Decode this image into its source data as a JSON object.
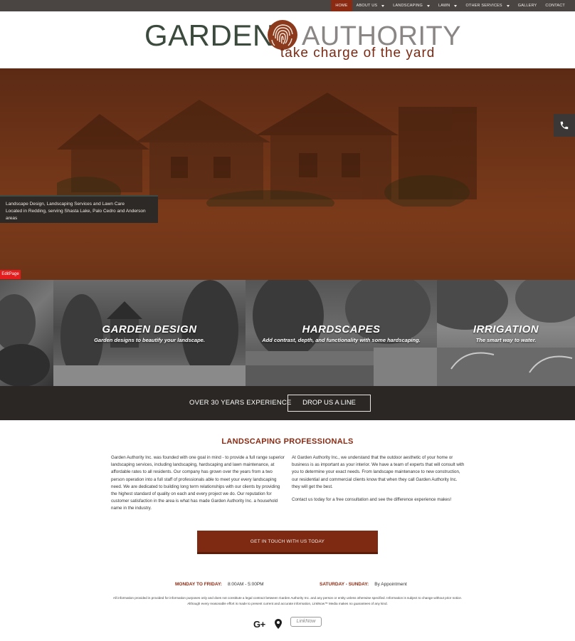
{
  "nav": {
    "items": [
      {
        "label": "HOME",
        "active": true,
        "dropdown": false
      },
      {
        "label": "ABOUT US",
        "active": false,
        "dropdown": true
      },
      {
        "label": "LANDSCAPING",
        "active": false,
        "dropdown": true
      },
      {
        "label": "LAWN",
        "active": false,
        "dropdown": true
      },
      {
        "label": "OTHER SERVICES",
        "active": false,
        "dropdown": true
      },
      {
        "label": "GALLERY",
        "active": false,
        "dropdown": false
      },
      {
        "label": "CONTACT",
        "active": false,
        "dropdown": false
      }
    ]
  },
  "logo": {
    "garden": "GARDEN",
    "authority": "AUTHORITY",
    "tagline": "take charge of the yard"
  },
  "hero": {
    "caption_line1": "Landscape Design, Landscaping Services and Lawn Care",
    "caption_line2": "Located in Redding, serving Shasta Lake, Palo Cedro and Anderson areas",
    "editpage": "EditPage",
    "phone_icon": "phone-icon"
  },
  "services": [
    {
      "title": "GARDEN DESIGN",
      "subtitle": "Garden designs to beautify your landscape."
    },
    {
      "title": "HARDSCAPES",
      "subtitle": "Add contrast, depth, and functionality with some hardscaping."
    },
    {
      "title": "IRRIGATION",
      "subtitle": "The smart way to water."
    }
  ],
  "strip": {
    "experience": "OVER 30 YEARS EXPERIENCE",
    "button": "DROP US A LINE"
  },
  "main": {
    "heading": "LANDSCAPING PROFESSIONALS",
    "left_text": "Garden Authority Inc. was founded with one goal in mind - to provide a full range superior landscaping services, including landscaping, hardscaping and lawn maintenance, at affordable rates to all residents. Our company has grown over the years from a two person operation into a full staff of professionals able to meet your every landscaping need. We are dedicated to building long term relationships with our clients by providing the highest standard of quality on each and every project we do. Our reputation for customer satisfaction in the area is what has made Garden Authority Inc. a household name in the industry.",
    "right_text_1": "At Garden Authority Inc., we understand that the outdoor aesthetic of your home or business is as important as your interior. We have a team of experts that will consult with you to determine your exact needs. From landscape maintenance to new construction, our residential and commercial clients know that when they call Garden Authority Inc. they will get the best.",
    "right_text_2": "Contact us today for a free consultation and see the difference experience makes!",
    "cta": "GET IN TOUCH WITH US TODAY"
  },
  "hours": {
    "weekday_label": "MONDAY TO FRIDAY:",
    "weekday_value": "8:00AM - 5:00PM",
    "weekend_label": "SATURDAY - SUNDAY:",
    "weekend_value": "By Appointment"
  },
  "footer": {
    "disclaimer": "All information provided is provided for information purposes only and does not constitute a legal contract between Garden Authority Inc. and any person or entity unless otherwise specified. Information is subject to change without prior notice. Although every reasonable effort is made to present current and accurate information, LinkNow™ Media makes no guarantees of any kind.",
    "gplus": "G+",
    "linknow": "LinkNow"
  },
  "colors": {
    "brand": "#8b2a12",
    "nav_bg": "#4a4543",
    "strip_bg": "#2b2724",
    "logo_green": "#3b4a3d"
  }
}
